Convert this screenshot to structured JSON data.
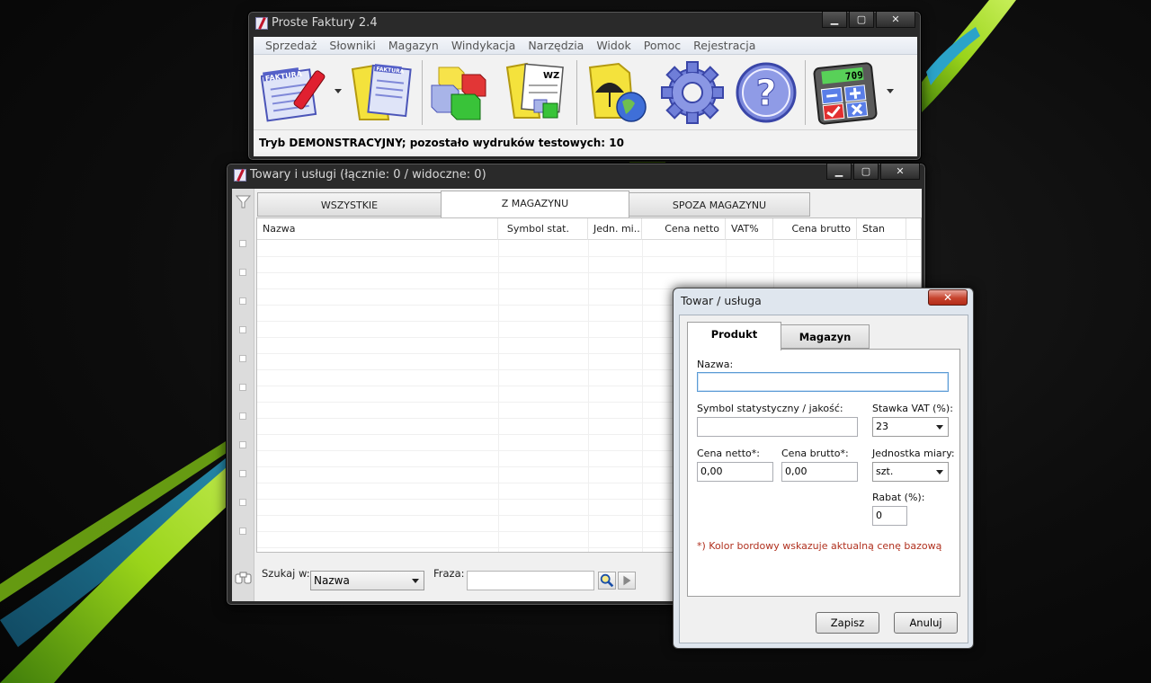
{
  "colors": {
    "desktop_background": "#0b0b0b",
    "swoosh_green": "#9ad41a",
    "swoosh_cyan": "#2ba3c9",
    "note_red": "#b0301e",
    "dialog_close_red": "#c6432d"
  },
  "main_window": {
    "title": "Proste Faktury 2.4",
    "menu": [
      "Sprzedaż",
      "Słowniki",
      "Magazyn",
      "Windykacja",
      "Narzędzia",
      "Widok",
      "Pomoc",
      "Rejestracja"
    ],
    "toolbar_icons": [
      {
        "name": "invoice-pen-icon",
        "text": "FAKTURA",
        "has_dropdown": true
      },
      {
        "name": "invoice-folder-icon",
        "text": "FAKTURA"
      },
      {
        "name": "warehouse-boxes-icon"
      },
      {
        "name": "wz-document-icon",
        "text": "WZ"
      },
      {
        "name": "umbrella-folder-icon"
      },
      {
        "name": "settings-gear-icon"
      },
      {
        "name": "help-icon",
        "text": "?"
      },
      {
        "name": "calculator-icon",
        "text": "709",
        "has_dropdown": true
      }
    ],
    "status": "Tryb DEMONSTRACYJNY; pozostało wydruków testowych: 10"
  },
  "products_window": {
    "title": "Towary i usługi (łącznie: 0 / widoczne: 0)",
    "tabs": [
      "WSZYSTKIE",
      "Z MAGAZYNU",
      "SPOZA MAGAZYNU"
    ],
    "active_tab": "Z MAGAZYNU",
    "columns": [
      "Nazwa",
      "Symbol stat.",
      "Jedn. mi...",
      "Cena netto",
      "VAT%",
      "Cena brutto",
      "Stan"
    ],
    "search_label": "Szukaj w:",
    "search_field": "Nazwa",
    "phrase_label": "Fraza:",
    "phrase_value": ""
  },
  "dialog": {
    "title": "Towar / usługa",
    "close_glyph": "✕",
    "tabs": [
      "Produkt",
      "Magazyn"
    ],
    "active_tab": "Produkt",
    "name_label": "Nazwa:",
    "name_value": "",
    "symbol_label": "Symbol statystyczny / jakość:",
    "symbol_value": "",
    "vat_label": "Stawka VAT (%):",
    "vat_value": "23",
    "net_label": "Cena netto*:",
    "net_value": "0,00",
    "gross_label": "Cena brutto*:",
    "gross_value": "0,00",
    "unit_label": "Jednostka miary:",
    "unit_value": "szt.",
    "discount_label": "Rabat (%):",
    "discount_value": "0",
    "note": "*) Kolor bordowy wskazuje aktualną cenę bazową",
    "save_button": "Zapisz",
    "cancel_button": "Anuluj"
  }
}
